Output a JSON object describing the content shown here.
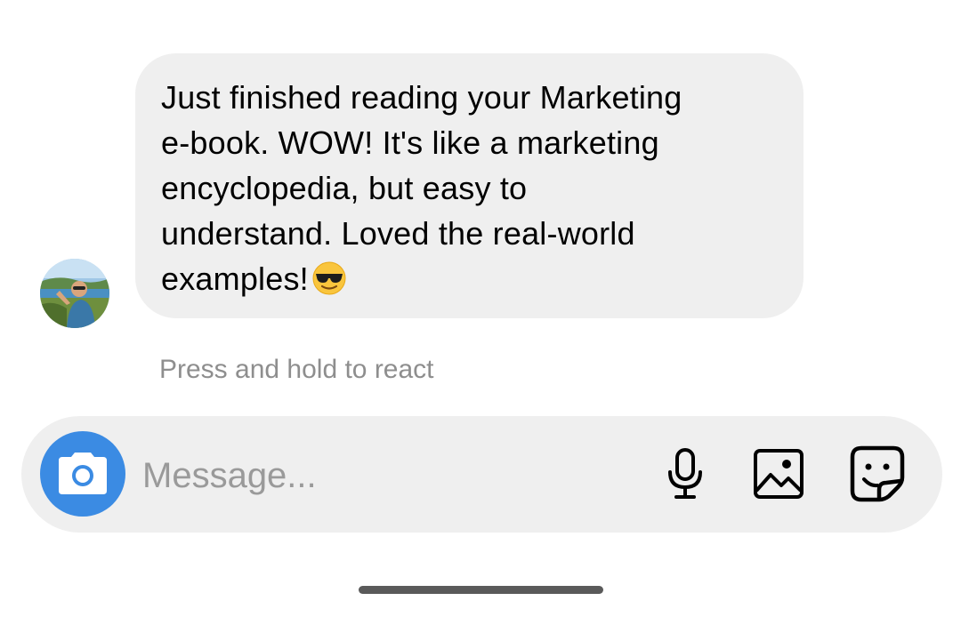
{
  "conversation": {
    "message": {
      "lines": [
        "Just finished reading your Marketing",
        "e-book. WOW! It's like a marketing",
        "encyclopedia, but easy to",
        "understand. Loved the real-world",
        "examples!"
      ],
      "emoji": "smiling-face-with-sunglasses",
      "sender_avatar": "avatar-photo"
    },
    "react_hint": "Press and hold to react"
  },
  "composer": {
    "placeholder": "Message...",
    "camera_icon": "camera-icon",
    "mic_icon": "microphone-icon",
    "gallery_icon": "image-icon",
    "sticker_icon": "sticker-icon",
    "accent_color": "#3b8be3"
  }
}
